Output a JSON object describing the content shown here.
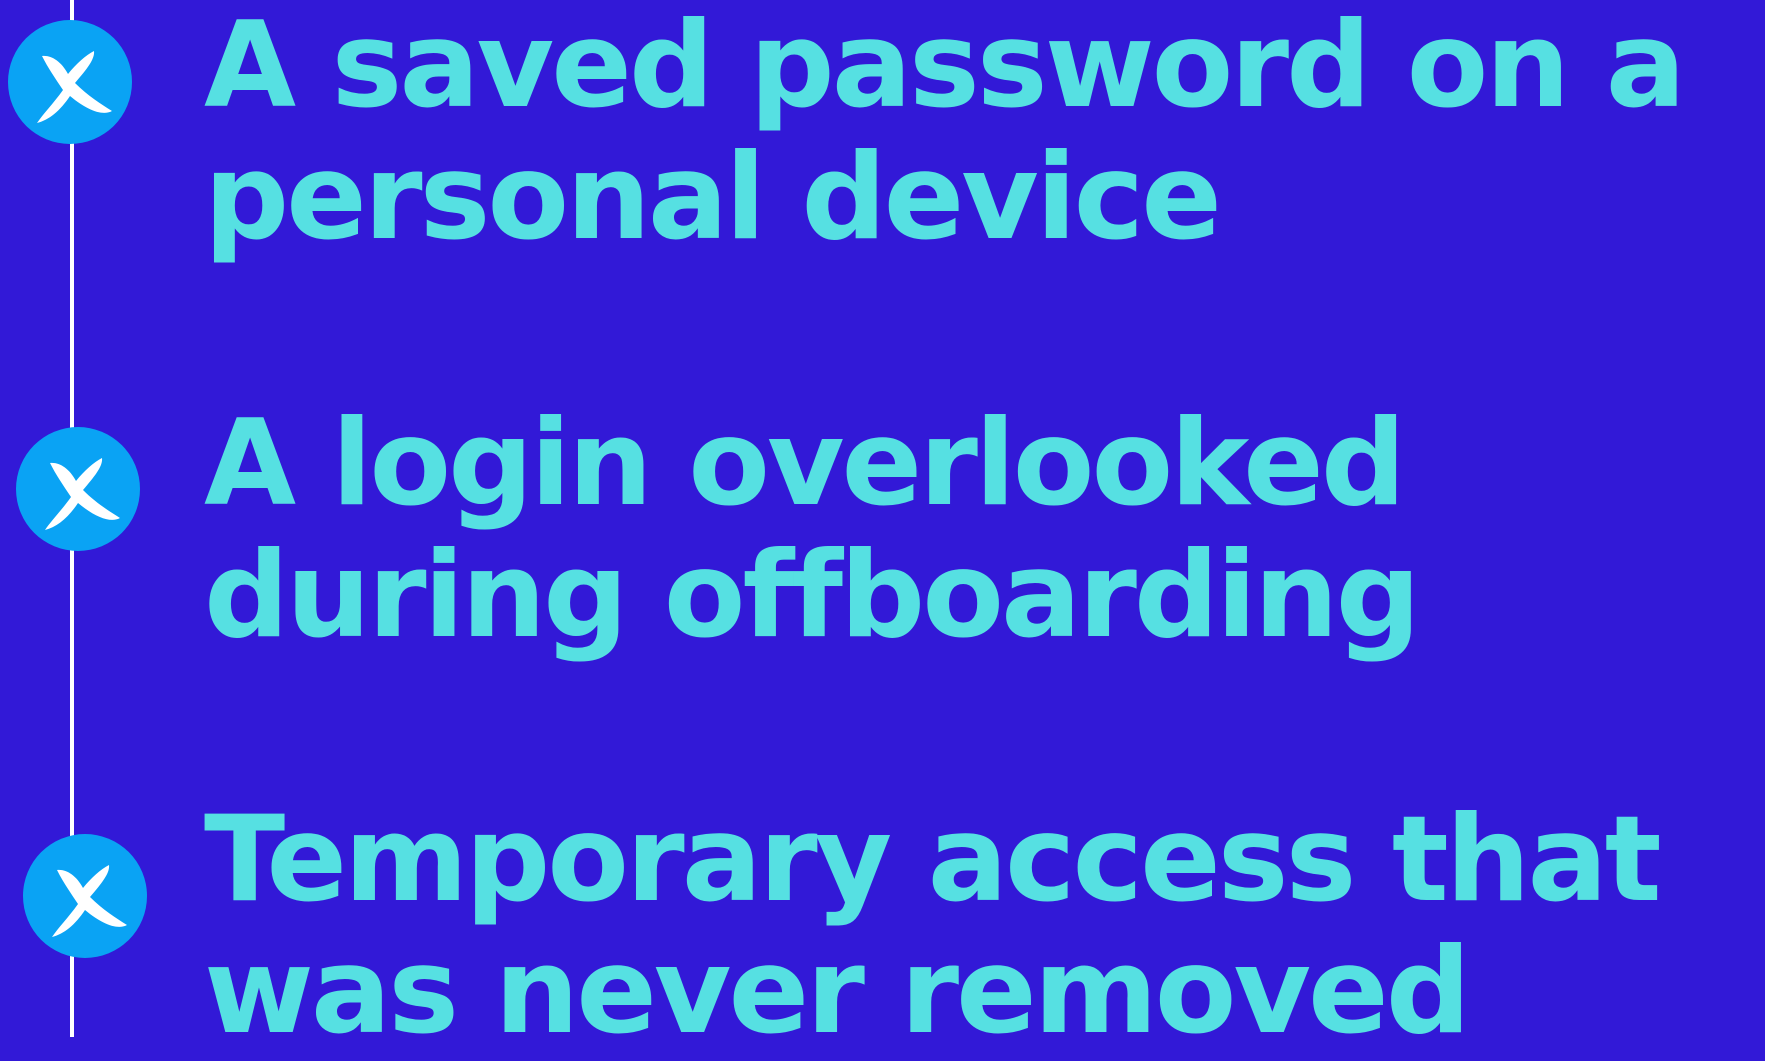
{
  "items": [
    {
      "icon": "x-mark-icon",
      "line1": "A saved password on a",
      "line2": "personal device"
    },
    {
      "icon": "x-mark-icon",
      "line1": "A login overlooked",
      "line2": "during offboarding"
    },
    {
      "icon": "x-mark-icon",
      "line1": "Temporary access that",
      "line2": "was never removed"
    }
  ],
  "colors": {
    "background": "#3219d7",
    "text": "#56e0e2",
    "marker": "#0aa3f4",
    "line": "#ffffff"
  }
}
